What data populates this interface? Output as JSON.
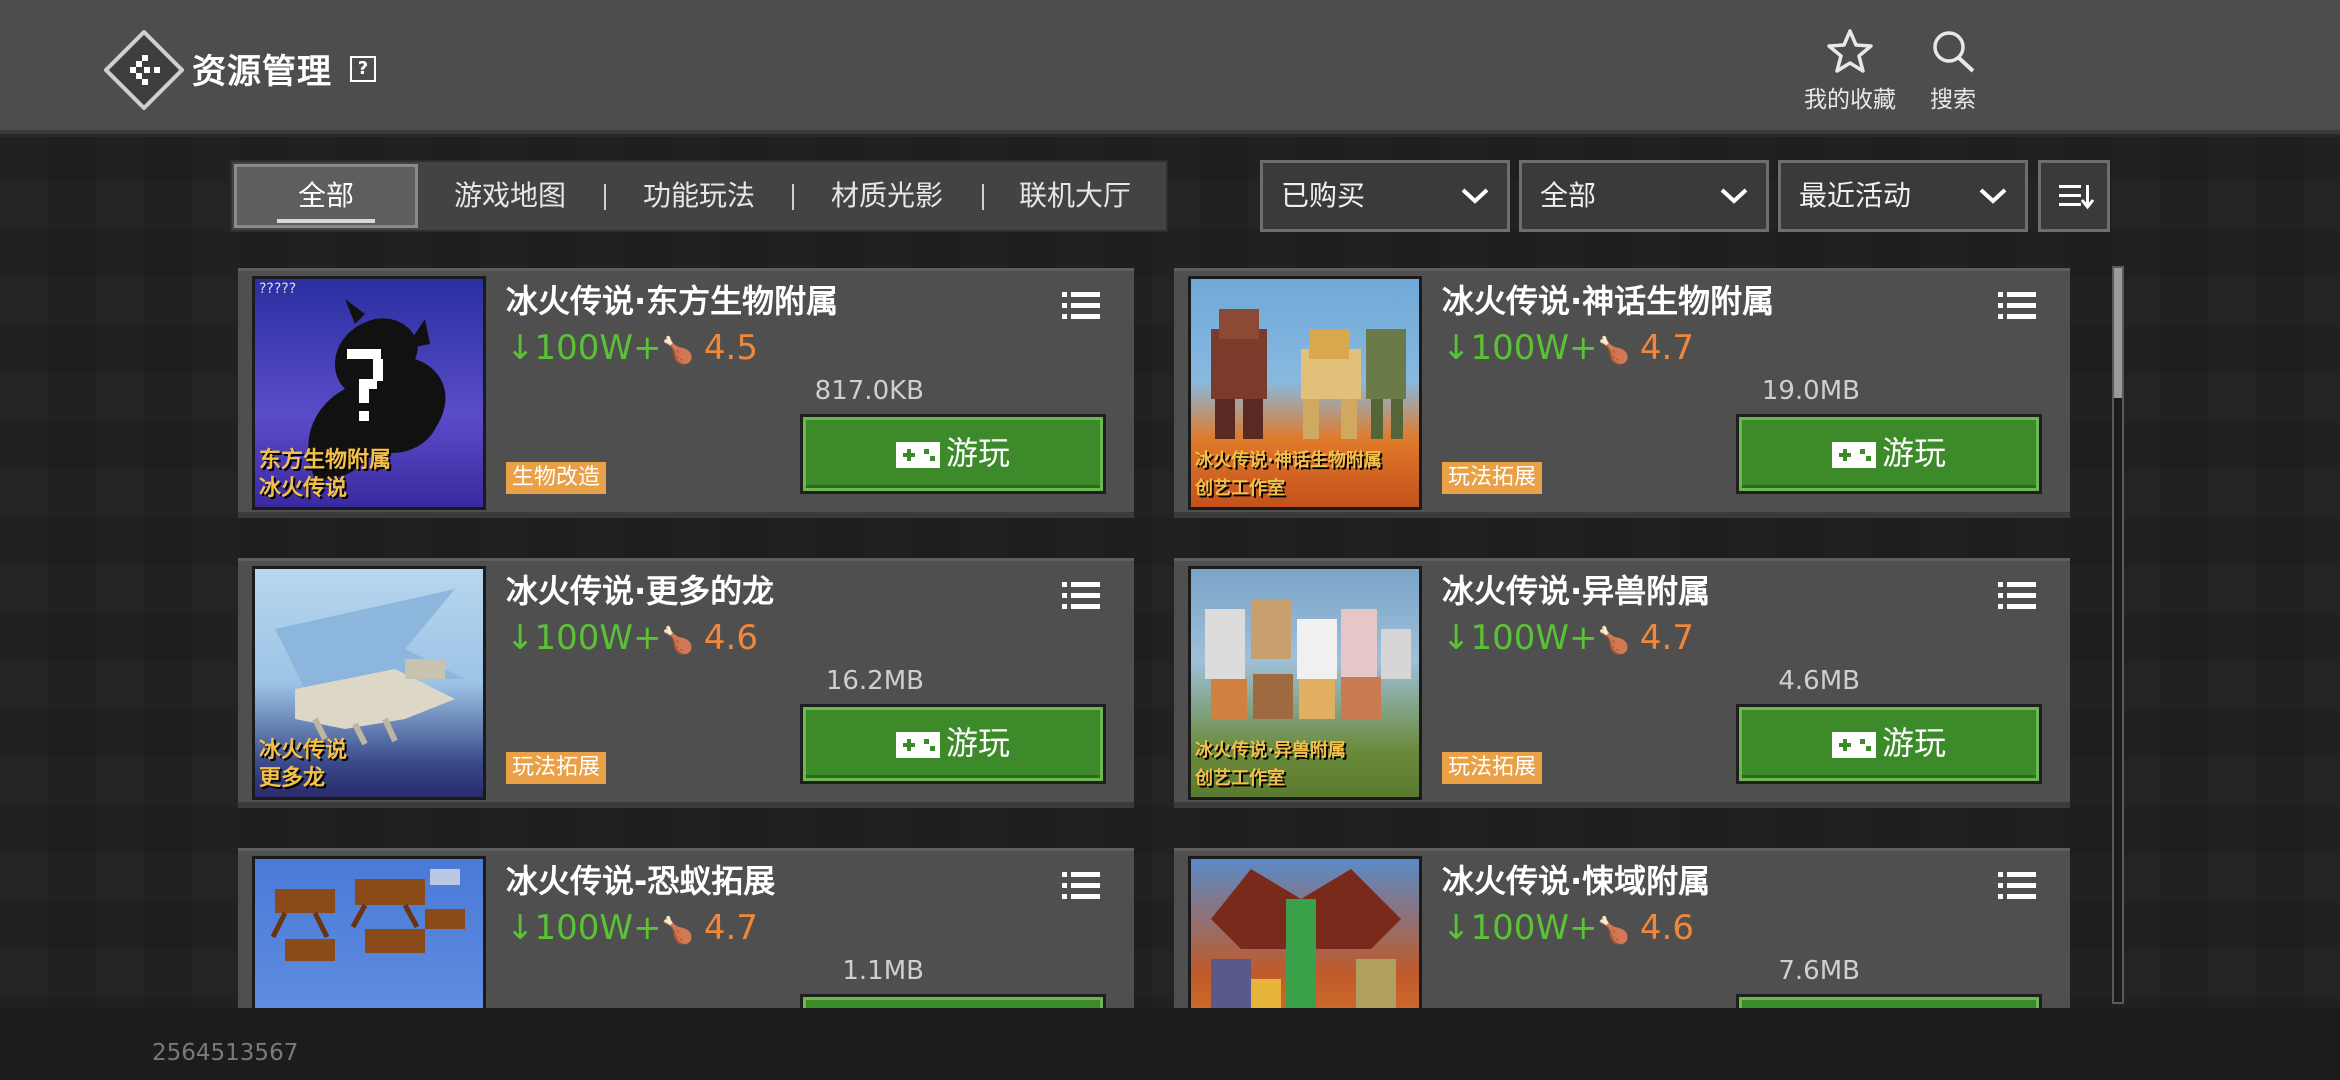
{
  "header": {
    "title": "资源管理",
    "help_icon": "?",
    "actions": [
      {
        "label": "我的收藏",
        "icon": "star-icon"
      },
      {
        "label": "搜索",
        "icon": "search-icon"
      }
    ]
  },
  "tabs": [
    {
      "label": "全部",
      "active": true
    },
    {
      "label": "游戏地图",
      "active": false
    },
    {
      "label": "功能玩法",
      "active": false
    },
    {
      "label": "材质光影",
      "active": false
    },
    {
      "label": "联机大厅",
      "active": false
    }
  ],
  "filters": {
    "purchase": "已购买",
    "category": "全部",
    "sort": "最近活动"
  },
  "play_label": "游玩",
  "items": [
    {
      "title": "冰火传说·东方生物附属",
      "downloads": "100W+",
      "rating": "4.5",
      "size": "817.0KB",
      "tag": "生物改造",
      "thumb_caption": [
        "东方生物附属",
        "冰火传说"
      ],
      "thumb_badge": "?????"
    },
    {
      "title": "冰火传说·神话生物附属",
      "downloads": "100W+",
      "rating": "4.7",
      "size": "19.0MB",
      "tag": "玩法拓展",
      "thumb_caption": [
        "冰火传说·神话生物附属",
        "创艺工作室"
      ]
    },
    {
      "title": "冰火传说·更多的龙",
      "downloads": "100W+",
      "rating": "4.6",
      "size": "16.2MB",
      "tag": "玩法拓展",
      "thumb_caption": [
        "冰火传说",
        "更多龙"
      ]
    },
    {
      "title": "冰火传说·异兽附属",
      "downloads": "100W+",
      "rating": "4.7",
      "size": "4.6MB",
      "tag": "玩法拓展",
      "thumb_caption": [
        "冰火传说·异兽附属",
        "创艺工作室"
      ]
    },
    {
      "title": "冰火传说-恐蚁拓展",
      "downloads": "100W+",
      "rating": "4.7",
      "size": "1.1MB",
      "tag": "",
      "thumb_caption": []
    },
    {
      "title": "冰火传说·悚域附属",
      "downloads": "100W+",
      "rating": "4.6",
      "size": "7.6MB",
      "tag": "",
      "thumb_caption": []
    }
  ],
  "footer": {
    "uid": "2564513567"
  },
  "colors": {
    "accent_green": "#3d8a2a",
    "download_green": "#5bc236",
    "rating_orange": "#f0873a",
    "tag_orange": "#e9a046"
  },
  "scroll_position": 0.0
}
